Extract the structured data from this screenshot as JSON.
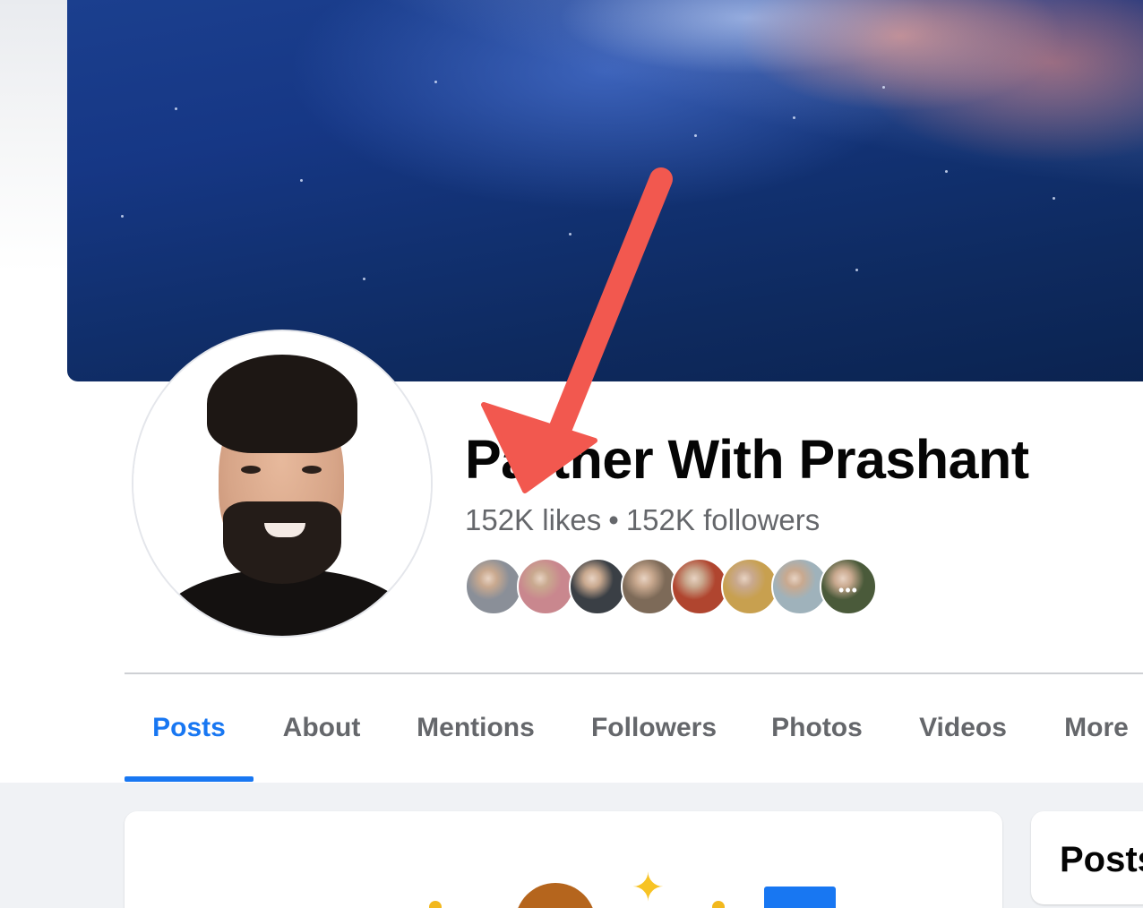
{
  "page": {
    "name": "Partner With Prashant",
    "likes": "152K likes",
    "separator": "•",
    "followers": "152K followers"
  },
  "followers_preview": {
    "count_shown": 8,
    "more_label": "•••",
    "colors": [
      "#8a8f98",
      "#c9878e",
      "#3a3f45",
      "#7d6a58",
      "#b0452f",
      "#c8a04f",
      "#9fb2bb",
      "#4a5a3a"
    ]
  },
  "tabs": [
    {
      "label": "Posts",
      "active": true
    },
    {
      "label": "About",
      "active": false
    },
    {
      "label": "Mentions",
      "active": false
    },
    {
      "label": "Followers",
      "active": false
    },
    {
      "label": "Photos",
      "active": false
    },
    {
      "label": "Videos",
      "active": false
    },
    {
      "label": "More",
      "active": false
    }
  ],
  "right_card": {
    "title": "Posts"
  },
  "icons": {
    "sparkle": "✦",
    "annotation": "red-arrow-icon"
  },
  "colors": {
    "accent": "#1877f2",
    "text_primary": "#050505",
    "text_secondary": "#65676b",
    "annotation": "#f2584f"
  }
}
